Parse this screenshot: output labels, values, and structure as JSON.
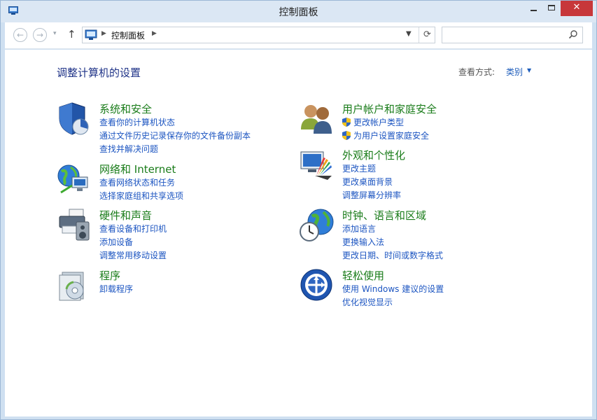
{
  "window": {
    "title": "控制面板"
  },
  "titlebar": {
    "minimize": "",
    "maximize": "",
    "close": "✕"
  },
  "nav": {
    "back": "←",
    "forward": "→",
    "up": "↑",
    "breadcrumb": [
      "控制面板"
    ],
    "refresh": "⟳",
    "search_placeholder": ""
  },
  "header": {
    "title": "调整计算机的设置",
    "view_label": "查看方式:",
    "view_value": "类别"
  },
  "categories": [
    {
      "title": "系统和安全",
      "icon": "system-security-icon",
      "links": [
        "查看你的计算机状态",
        "通过文件历史记录保存你的文件备份副本",
        "查找并解决问题"
      ]
    },
    {
      "title": "网络和 Internet",
      "icon": "network-icon",
      "links": [
        "查看网络状态和任务",
        "选择家庭组和共享选项"
      ]
    },
    {
      "title": "硬件和声音",
      "icon": "hardware-sound-icon",
      "links": [
        "查看设备和打印机",
        "添加设备",
        "调整常用移动设置"
      ]
    },
    {
      "title": "程序",
      "icon": "programs-icon",
      "links": [
        "卸载程序"
      ]
    },
    {
      "title": "用户帐户和家庭安全",
      "icon": "user-accounts-icon",
      "links": [
        "更改帐户类型",
        "为用户设置家庭安全"
      ]
    },
    {
      "title": "外观和个性化",
      "icon": "appearance-icon",
      "links": [
        "更改主题",
        "更改桌面背景",
        "调整屏幕分辨率"
      ]
    },
    {
      "title": "时钟、语言和区域",
      "icon": "clock-region-icon",
      "links": [
        "添加语言",
        "更换输入法",
        "更改日期、时间或数字格式"
      ]
    },
    {
      "title": "轻松使用",
      "icon": "ease-of-access-icon",
      "links": [
        "使用 Windows 建议的设置",
        "优化视觉显示"
      ]
    }
  ],
  "colors": {
    "category_title": "#1a7c1a",
    "link": "#1c55c1",
    "page_title": "#1e3287",
    "close_button": "#c7373a"
  }
}
